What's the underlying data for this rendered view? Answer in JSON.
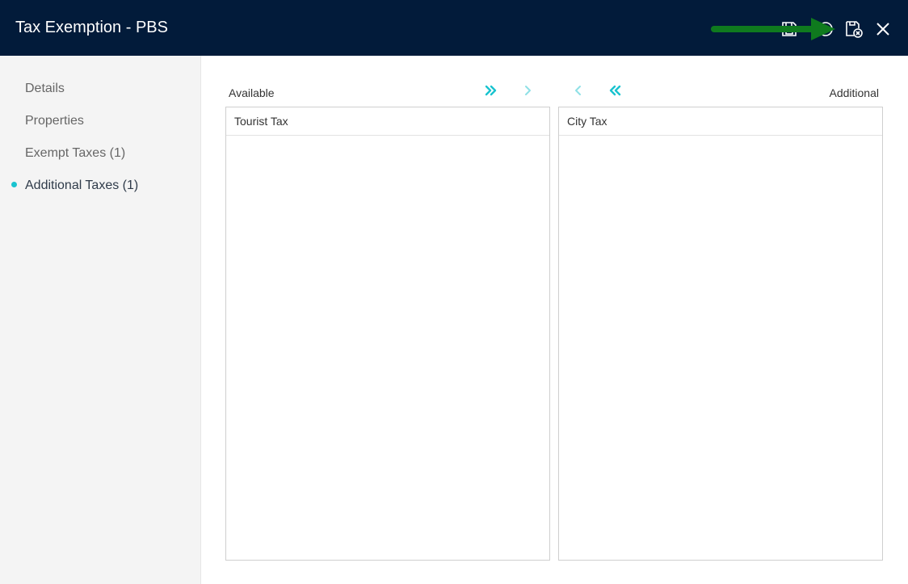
{
  "window": {
    "title": "Tax Exemption - PBS"
  },
  "header_icons": [
    "save-icon",
    "history-icon",
    "save-and-close-icon",
    "close-icon"
  ],
  "sidebar": {
    "items": [
      {
        "label": "Details"
      },
      {
        "label": "Properties"
      },
      {
        "label": "Exempt Taxes (1)"
      },
      {
        "label": "Additional Taxes (1)",
        "active": true
      }
    ]
  },
  "transfer": {
    "available_label": "Available",
    "additional_label": "Additional",
    "available_items": [
      "Tourist Tax"
    ],
    "additional_items": [
      "City Tax"
    ]
  },
  "colors": {
    "header_bg": "#021b3a",
    "accent": "#19c3cf",
    "annotation_arrow": "#0f7a1e"
  }
}
